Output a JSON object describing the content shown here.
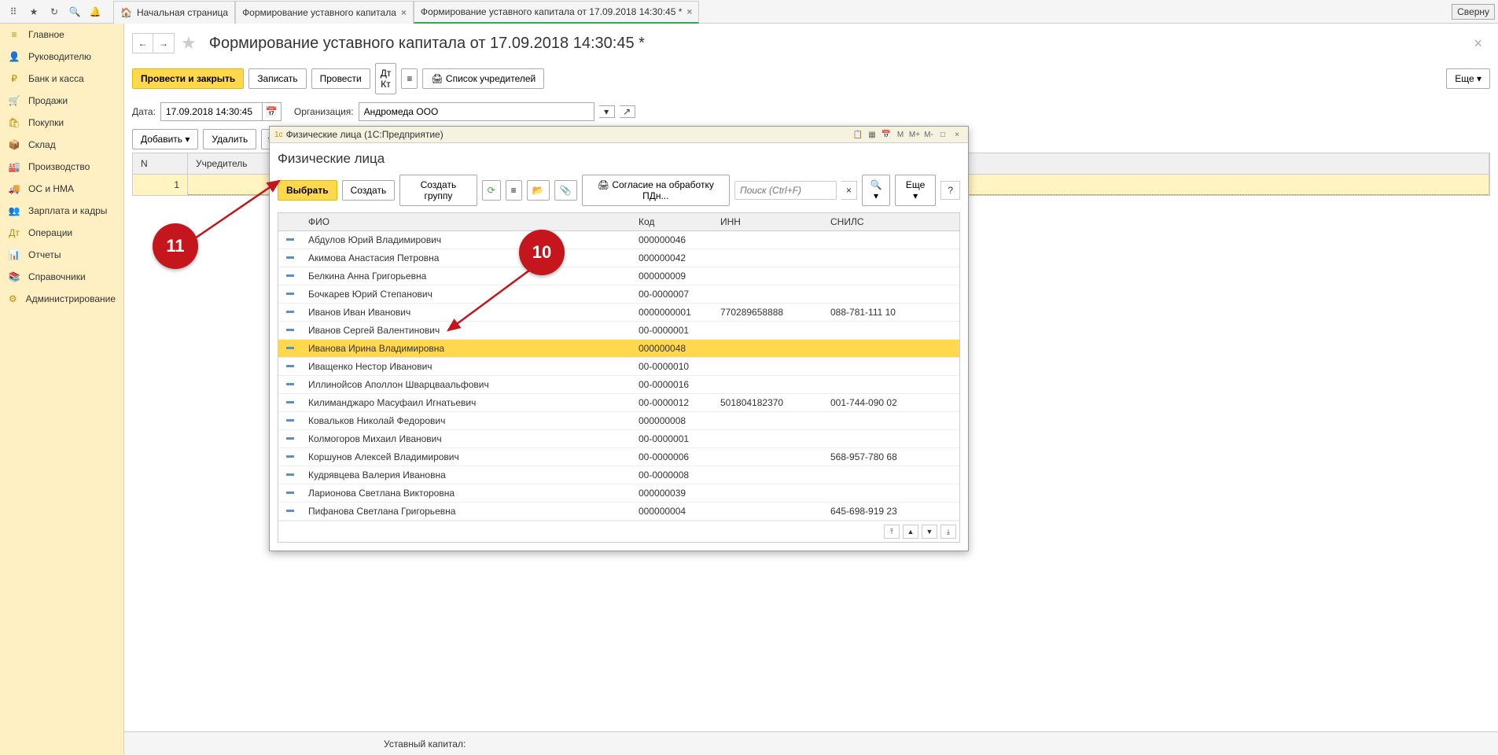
{
  "top": {
    "tabs": [
      {
        "label": "Начальная страница",
        "icon": "🏠"
      },
      {
        "label": "Формирование уставного капитала",
        "closable": true
      },
      {
        "label": "Формирование уставного капитала от 17.09.2018 14:30:45 *",
        "closable": true
      }
    ],
    "collapse": "Сверну"
  },
  "nav": [
    {
      "icon": "≡",
      "label": "Главное"
    },
    {
      "icon": "👤",
      "label": "Руководителю"
    },
    {
      "icon": "₽",
      "label": "Банк и касса"
    },
    {
      "icon": "🛒",
      "label": "Продажи"
    },
    {
      "icon": "🛍",
      "label": "Покупки"
    },
    {
      "icon": "📦",
      "label": "Склад"
    },
    {
      "icon": "🏭",
      "label": "Производство"
    },
    {
      "icon": "🚚",
      "label": "ОС и НМА"
    },
    {
      "icon": "👥",
      "label": "Зарплата и кадры"
    },
    {
      "icon": "Дт",
      "label": "Операции"
    },
    {
      "icon": "📊",
      "label": "Отчеты"
    },
    {
      "icon": "📚",
      "label": "Справочники"
    },
    {
      "icon": "⚙",
      "label": "Администрирование"
    }
  ],
  "page": {
    "title": "Формирование уставного капитала от 17.09.2018 14:30:45 *",
    "buttons": {
      "post_close": "Провести и закрыть",
      "save": "Записать",
      "post": "Провести",
      "founders_list": "Список учредителей",
      "more": "Еще"
    },
    "form": {
      "date_label": "Дата:",
      "date_value": "17.09.2018 14:30:45",
      "org_label": "Организация:",
      "org_value": "Андромеда ООО"
    },
    "grid_tb": {
      "add": "Добавить",
      "delete": "Удалить"
    },
    "grid_headers": {
      "n": "N",
      "founder": "Учредитель"
    },
    "grid_row1_n": "1",
    "footer": "Уставный капитал:"
  },
  "popup": {
    "window_title": "Физические лица (1C:Предприятие)",
    "heading": "Физические лица",
    "buttons": {
      "select": "Выбрать",
      "create": "Создать",
      "create_group": "Создать группу",
      "consent": "Согласие на обработку ПДн...",
      "more": "Еще",
      "search_placeholder": "Поиск (Ctrl+F)"
    },
    "headers": {
      "fio": "ФИО",
      "code": "Код",
      "inn": "ИНН",
      "snils": "СНИЛС"
    },
    "rows": [
      {
        "fio": "Абдулов Юрий Владимирович",
        "code": "000000046"
      },
      {
        "fio": "Акимова Анастасия Петровна",
        "code": "000000042"
      },
      {
        "fio": "Белкина Анна  Григорьевна",
        "code": "000000009"
      },
      {
        "fio": "Бочкарев Юрий Степанович",
        "code": "00-0000007"
      },
      {
        "fio": "Иванов Иван Иванович",
        "code": "0000000001",
        "inn": "770289658888",
        "snils": "088-781-111 10"
      },
      {
        "fio": "Иванов Сергей Валентинович",
        "code": "00-0000001"
      },
      {
        "fio": "Иванова Ирина Владимировна",
        "code": "000000048",
        "selected": true
      },
      {
        "fio": "Иващенко Нестор Иванович",
        "code": "00-0000010"
      },
      {
        "fio": "Иллинойсов Аполлон Шварцваальфович",
        "code": "00-0000016"
      },
      {
        "fio": "Килиманджаро Масуфаил Игнатьевич",
        "code": "00-0000012",
        "inn": "501804182370",
        "snils": "001-744-090 02"
      },
      {
        "fio": "Ковальков  Николай Федорович",
        "code": "000000008"
      },
      {
        "fio": "Колмогоров Михаил Иванович",
        "code": "00-0000001"
      },
      {
        "fio": "Коршунов Алексей Владимирович",
        "code": "00-0000006",
        "snils": "568-957-780 68"
      },
      {
        "fio": "Кудрявцева Валерия Ивановна",
        "code": "00-0000008"
      },
      {
        "fio": "Ларионова Светлана Викторовна",
        "code": "000000039"
      },
      {
        "fio": "Пифанова Светлана Григорьевна",
        "code": "000000004",
        "snils": "645-698-919 23"
      }
    ]
  },
  "annotations": {
    "n10": "10",
    "n11": "11"
  }
}
